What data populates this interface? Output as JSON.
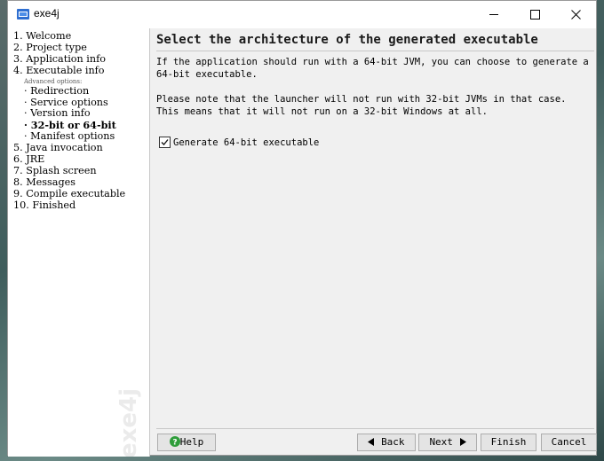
{
  "window": {
    "title": "exe4j",
    "app_icon": "exe4j-app-icon",
    "controls": {
      "minimize": "minimize-icon",
      "maximize": "maximize-icon",
      "close": "close-icon"
    }
  },
  "sidebar": {
    "items": [
      {
        "label": "1. Welcome"
      },
      {
        "label": "2. Project type"
      },
      {
        "label": "3. Application info"
      },
      {
        "label": "4. Executable info"
      },
      {
        "label": "Advanced options:"
      },
      {
        "label": "Redirection"
      },
      {
        "label": "Service options"
      },
      {
        "label": "Version info"
      },
      {
        "label": "32-bit or 64-bit"
      },
      {
        "label": "Manifest options"
      },
      {
        "label": "5. Java invocation"
      },
      {
        "label": "6. JRE"
      },
      {
        "label": "7. Splash screen"
      },
      {
        "label": "8. Messages"
      },
      {
        "label": "9. Compile executable"
      },
      {
        "label": "10. Finished"
      }
    ],
    "watermark": "exe4j"
  },
  "content": {
    "heading": "Select the architecture of the generated executable",
    "paragraph1": [
      "If the application should run with a 64-bit JVM, you can choose to generate a",
      "64-bit executable."
    ],
    "paragraph2": [
      "Please note that the launcher will not run with 32-bit JVMs in that case.",
      "This means that it will not run on a 32-bit Windows at all."
    ],
    "checkbox": {
      "label": "Generate 64-bit executable",
      "checked": true
    }
  },
  "footer": {
    "help": "Help",
    "back": "Back",
    "next": "Next",
    "finish": "Finish",
    "cancel": "Cancel"
  },
  "colors": {
    "help_icon": "#2e9d3a"
  }
}
